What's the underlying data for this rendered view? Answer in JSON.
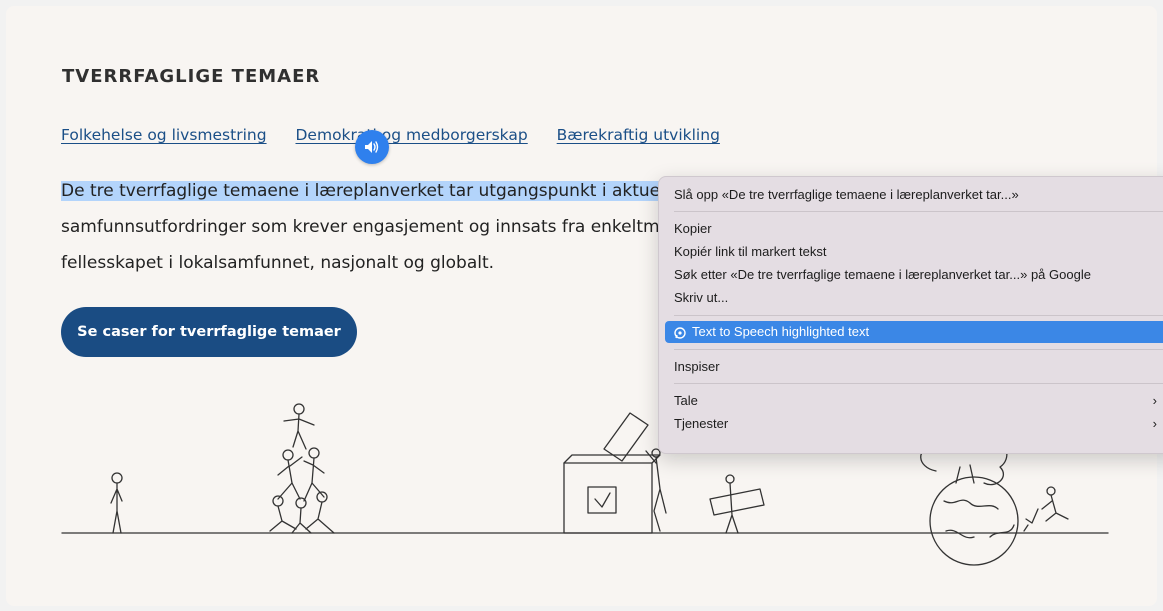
{
  "section": {
    "heading": "TVERRFAGLIGE TEMAER",
    "topic_links": [
      {
        "label": "Folkehelse og livsmestring"
      },
      {
        "label": "Demokrati og medborgerskap"
      },
      {
        "label": "Bærekraftig utvikling"
      }
    ],
    "paragraph": {
      "line1_highlighted": "De tre tverrfaglige temaene i læreplanverket tar utgangspunkt i aktuelle",
      "line2": "samfunnsutfordringer som krever engasjement og innsats fra enkeltmennesker og",
      "line3": "fellesskapet i lokalsamfunnet, nasjonalt og globalt."
    },
    "cta_label": "Se caser for tverrfaglige temaer"
  },
  "icons": {
    "speaker": "speaker-icon",
    "tts": "tts-bubble-icon",
    "submenu": "chevron-right-icon"
  },
  "context_menu": {
    "lookup": "Slå opp «De tre tverrfaglige temaene i læreplanverket tar...»",
    "copy": "Kopier",
    "copy_link": "Kopiér link til markert tekst",
    "search_google": "Søk etter «De tre tverrfaglige temaene i læreplanverket tar...» på Google",
    "print": "Skriv ut...",
    "tts": "Text to Speech highlighted text",
    "inspect": "Inspiser",
    "speech": "Tale",
    "services": "Tjenester"
  },
  "colors": {
    "accent_blue": "#1a4c83",
    "link_blue": "#1b4f87",
    "selection": "#b3d4fb",
    "menu_highlight": "#3b87e6",
    "speaker_button": "#2f80ed"
  }
}
